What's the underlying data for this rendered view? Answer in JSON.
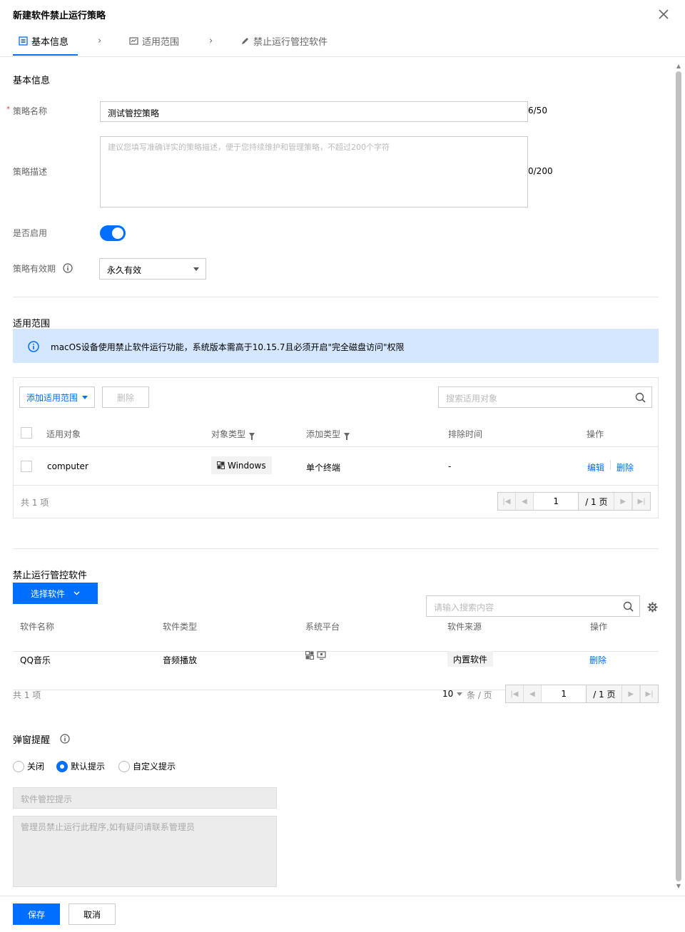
{
  "dialog": {
    "title": "新建软件禁止运行策略"
  },
  "steps": [
    {
      "label": "基本信息"
    },
    {
      "label": "适用范围"
    },
    {
      "label": "禁止运行管控软件"
    }
  ],
  "basic": {
    "section_title": "基本信息",
    "name_label": "策略名称",
    "name_value": "测试管控策略",
    "name_counter": "6/50",
    "desc_label": "策略描述",
    "desc_placeholder": "建议您填写准确详实的策略描述，便于您持续维护和管理策略，不超过200个字符",
    "desc_counter": "0/200",
    "enable_label": "是否启用",
    "enabled": true,
    "validity_label": "策略有效期",
    "validity_value": "永久有效"
  },
  "scope": {
    "section_title": "适用范围",
    "alert": "macOS设备使用禁止软件运行功能，系统版本需高于10.15.7且必须开启\"完全磁盘访问\"权限",
    "add_button": "添加适用范围",
    "delete_button": "删除",
    "search_placeholder": "搜索适用对象",
    "columns": [
      "适用对象",
      "对象类型",
      "添加类型",
      "排除时间",
      "操作"
    ],
    "rows": [
      {
        "target": "computer",
        "object_type": "Windows",
        "add_type": "单个终端",
        "exclude_time": "-",
        "edit": "编辑",
        "delete": "删除"
      }
    ],
    "total": "共 1 项",
    "page_current": "1",
    "page_total": "/ 1 页"
  },
  "software": {
    "section_title": "禁止运行管控软件",
    "select_button": "选择软件",
    "search_placeholder": "请输入搜索内容",
    "columns": [
      "软件名称",
      "软件类型",
      "系统平台",
      "软件来源",
      "操作"
    ],
    "rows": [
      {
        "name": "QQ音乐",
        "type": "音频播放",
        "source": "内置软件",
        "delete": "删除"
      }
    ],
    "total": "共 1 项",
    "page_size": "10",
    "page_size_unit": "条 / 页",
    "page_current": "1",
    "page_total": "/ 1 页"
  },
  "popup": {
    "section_title": "弹窗提醒",
    "options": [
      "关闭",
      "默认提示",
      "自定义提示"
    ],
    "selected": "默认提示",
    "title_placeholder": "软件管控提示",
    "message_placeholder": "管理员禁止运行此程序,如有疑问请联系管理员"
  },
  "footer": {
    "save": "保存",
    "cancel": "取消"
  },
  "colors": {
    "accent": "#006eff",
    "alert_bg": "#d5e7ff",
    "required": "#e54545"
  }
}
